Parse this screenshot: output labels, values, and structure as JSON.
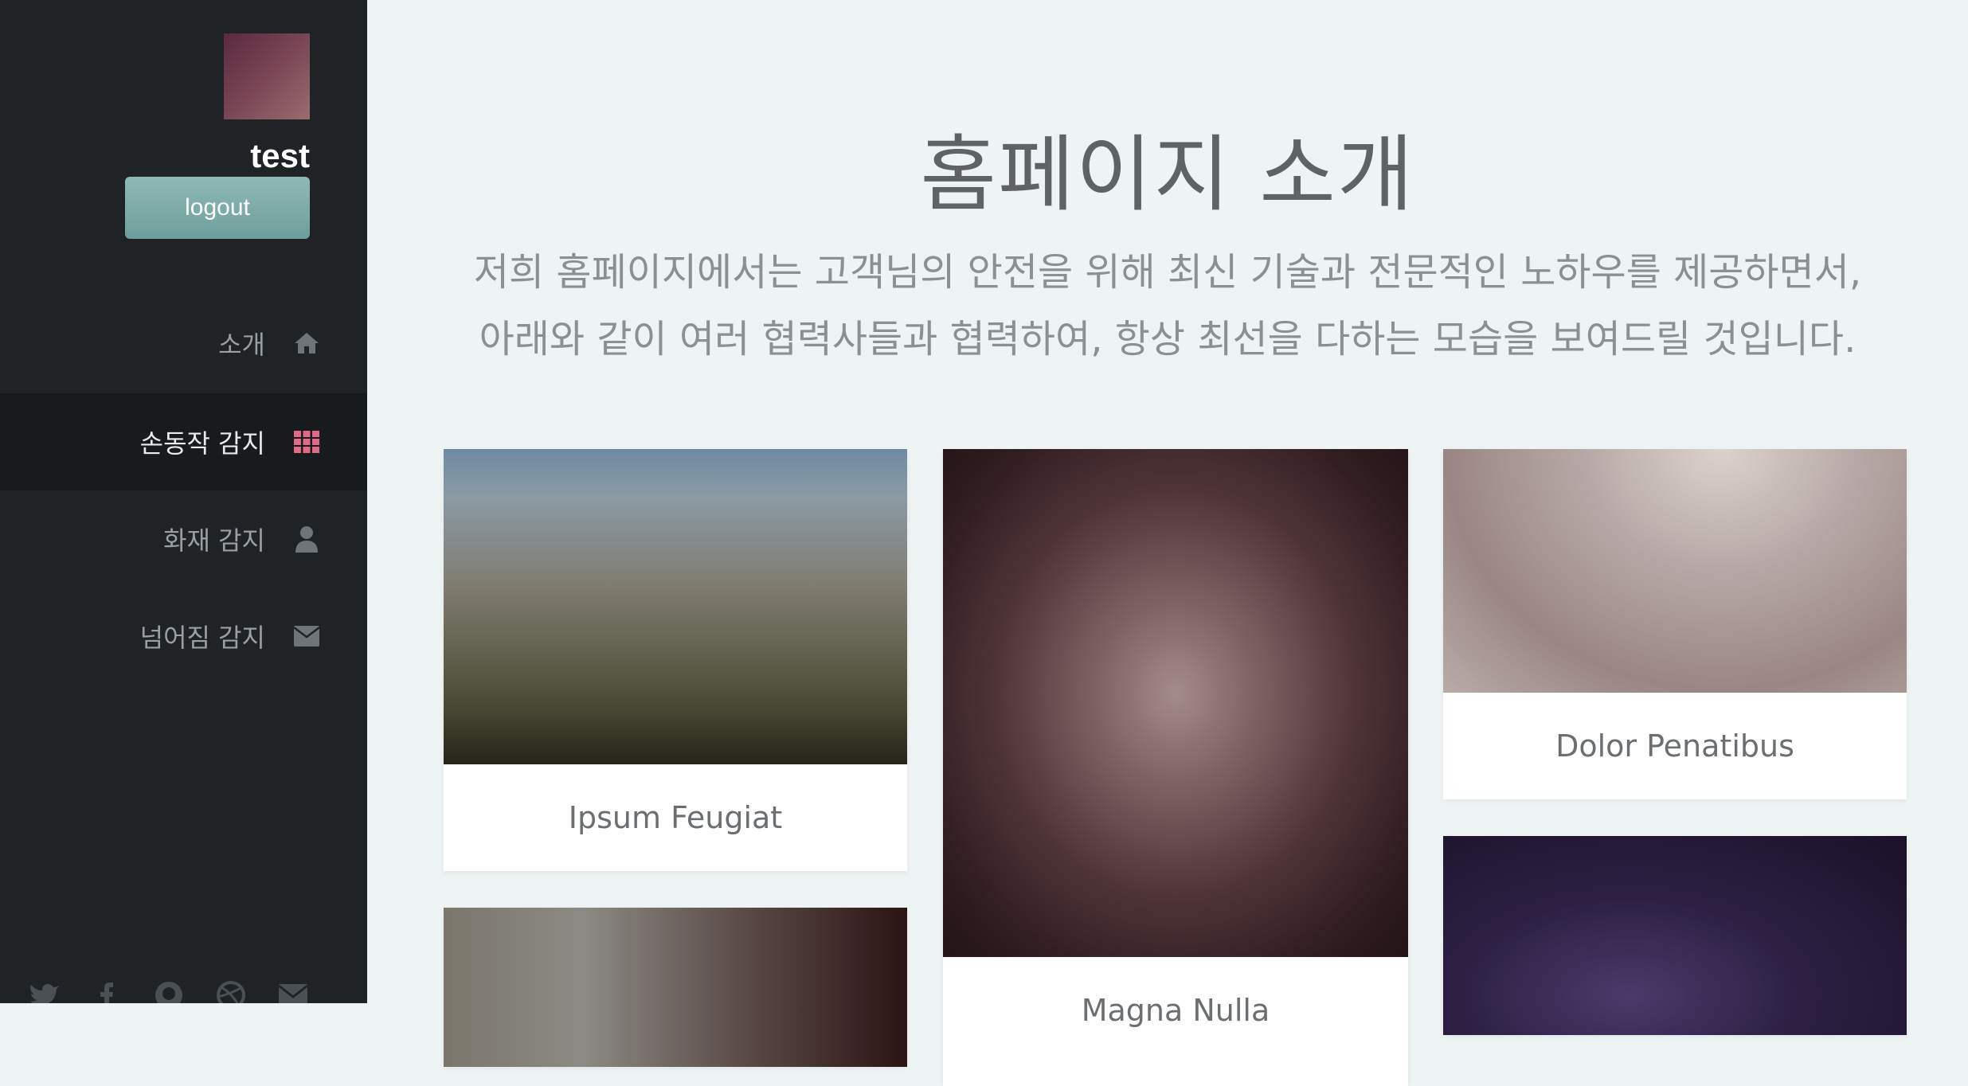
{
  "sidebar": {
    "username": "test",
    "logout_label": "logout",
    "nav": [
      {
        "label": "소개",
        "icon": "home-icon",
        "active": false
      },
      {
        "label": "손동작 감지",
        "icon": "grid-icon",
        "active": true
      },
      {
        "label": "화재 감지",
        "icon": "user-icon",
        "active": false
      },
      {
        "label": "넘어짐 감지",
        "icon": "envelope-icon",
        "active": false
      }
    ],
    "social": [
      "twitter-icon",
      "facebook-icon",
      "github-icon",
      "dribbble-icon",
      "envelope-icon"
    ]
  },
  "main": {
    "title": "홈페이지 소개",
    "intro_line1": "저희 홈페이지에서는 고객님의 안전을 위해 최신 기술과 전문적인 노하우를 제공하면서,",
    "intro_line2": "아래와 같이 여러 협력사들과 협력하여, 항상 최선을 다하는 모습을 보여드릴 것입니다.",
    "cards": [
      {
        "caption": "Ipsum Feugiat"
      },
      {
        "caption": "Magna Nulla"
      },
      {
        "caption": "Dolor Penatibus"
      }
    ]
  },
  "colors": {
    "sidebar_bg": "#1f2326",
    "active_bg": "#181b1d",
    "accent_grid": "#e06a86",
    "page_bg": "#eef3f3",
    "logout_bg": "#7fadaa"
  }
}
